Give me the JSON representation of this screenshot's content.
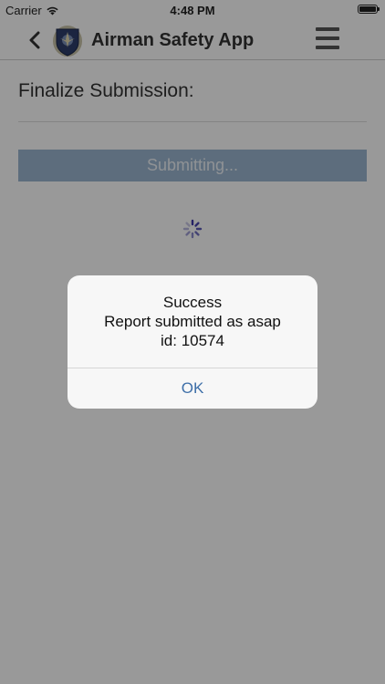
{
  "status_bar": {
    "carrier": "Carrier",
    "time": "4:48 PM"
  },
  "nav": {
    "title": "Airman Safety App",
    "back_icon": "chevron-left-icon",
    "menu_icon": "hamburger-menu-icon",
    "logo": "air-force-shield-logo"
  },
  "page": {
    "title": "Finalize Submission:",
    "submit_label": "Submitting...",
    "submit_color": "#9cb6d1"
  },
  "alert": {
    "title": "Success",
    "message": "Report submitted as asap",
    "id_text": "id: 10574",
    "ok_label": "OK",
    "ok_color": "#3e6fa8"
  }
}
